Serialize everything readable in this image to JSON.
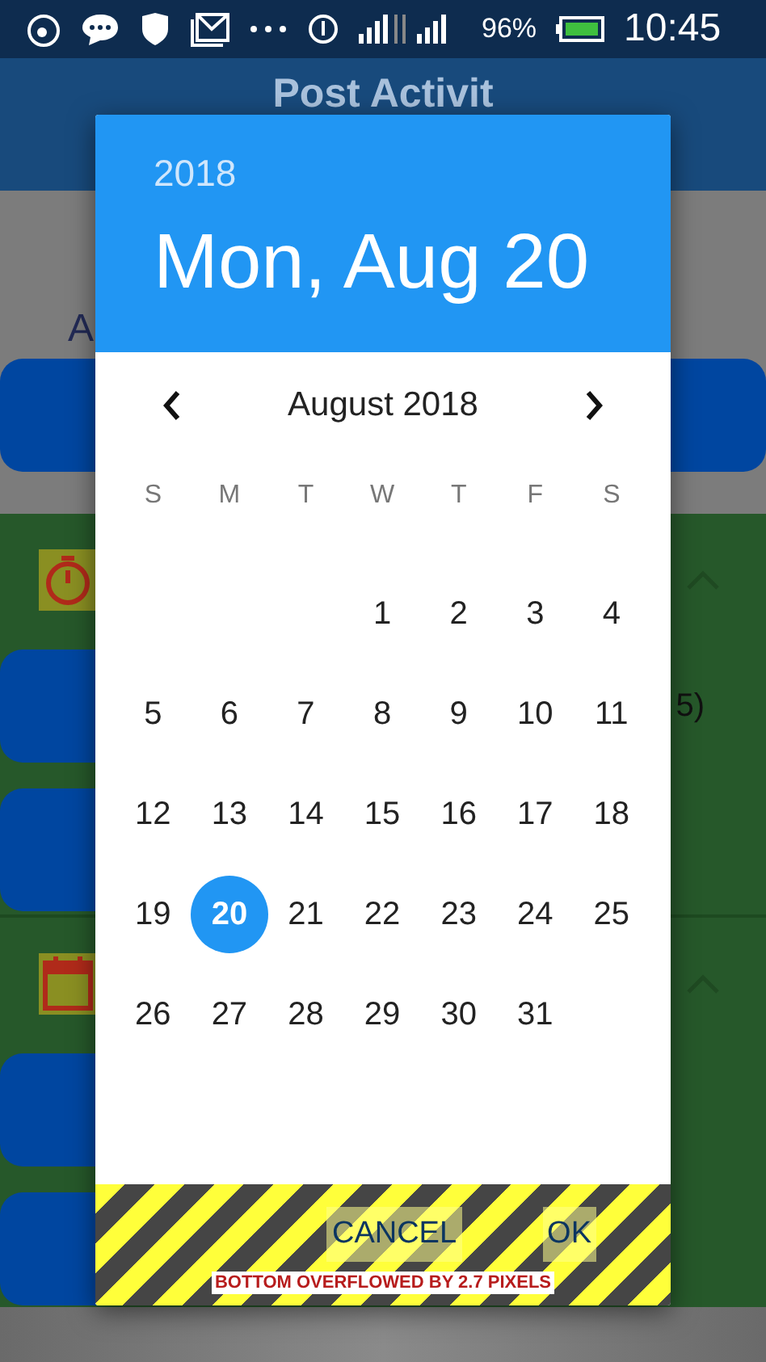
{
  "status_bar": {
    "battery": "96%",
    "time": "10:45"
  },
  "app_bar": {
    "title": "Post Activit"
  },
  "background": {
    "label": "A",
    "sections": [
      {
        "kind": "timer",
        "expanded": true,
        "note": "5)"
      },
      {
        "kind": "calendar",
        "expanded": true
      }
    ]
  },
  "date_picker": {
    "year": "2018",
    "date": "Mon, Aug 20",
    "month": "August 2018",
    "weekdays": [
      "S",
      "M",
      "T",
      "W",
      "T",
      "F",
      "S"
    ],
    "weeks": [
      {
        "kind": "partial",
        "days": [
          {
            "label": "1",
            "selected": false
          },
          {
            "label": "2",
            "selected": false
          },
          {
            "label": "3",
            "selected": false
          },
          {
            "label": "4",
            "selected": false
          }
        ]
      },
      {
        "kind": "full",
        "days": [
          {
            "label": "5",
            "selected": false
          },
          {
            "label": "6",
            "selected": false
          },
          {
            "label": "7",
            "selected": false
          },
          {
            "label": "8",
            "selected": false
          },
          {
            "label": "9",
            "selected": false
          },
          {
            "label": "10",
            "selected": false
          },
          {
            "label": "11",
            "selected": false
          }
        ]
      },
      {
        "kind": "full",
        "days": [
          {
            "label": "12",
            "selected": false
          },
          {
            "label": "13",
            "selected": false
          },
          {
            "label": "14",
            "selected": false
          },
          {
            "label": "15",
            "selected": false
          },
          {
            "label": "16",
            "selected": false
          },
          {
            "label": "17",
            "selected": false
          },
          {
            "label": "18",
            "selected": false
          }
        ]
      },
      {
        "kind": "full",
        "days": [
          {
            "label": "19",
            "selected": false
          },
          {
            "label": "20",
            "selected": true
          },
          {
            "label": "21",
            "selected": false
          },
          {
            "label": "22",
            "selected": false
          },
          {
            "label": "23",
            "selected": false
          },
          {
            "label": "24",
            "selected": false
          },
          {
            "label": "25",
            "selected": false
          }
        ]
      },
      {
        "kind": "full",
        "days": [
          {
            "label": "26",
            "selected": false
          },
          {
            "label": "27",
            "selected": false
          },
          {
            "label": "28",
            "selected": false
          },
          {
            "label": "29",
            "selected": false
          },
          {
            "label": "30",
            "selected": false
          },
          {
            "label": "31",
            "selected": false
          }
        ]
      }
    ],
    "buttons": [
      "CANCEL",
      "OK"
    ],
    "overflow_warning": "BOTTOM OVERFLOWED BY 2.7 PIXELS"
  }
}
